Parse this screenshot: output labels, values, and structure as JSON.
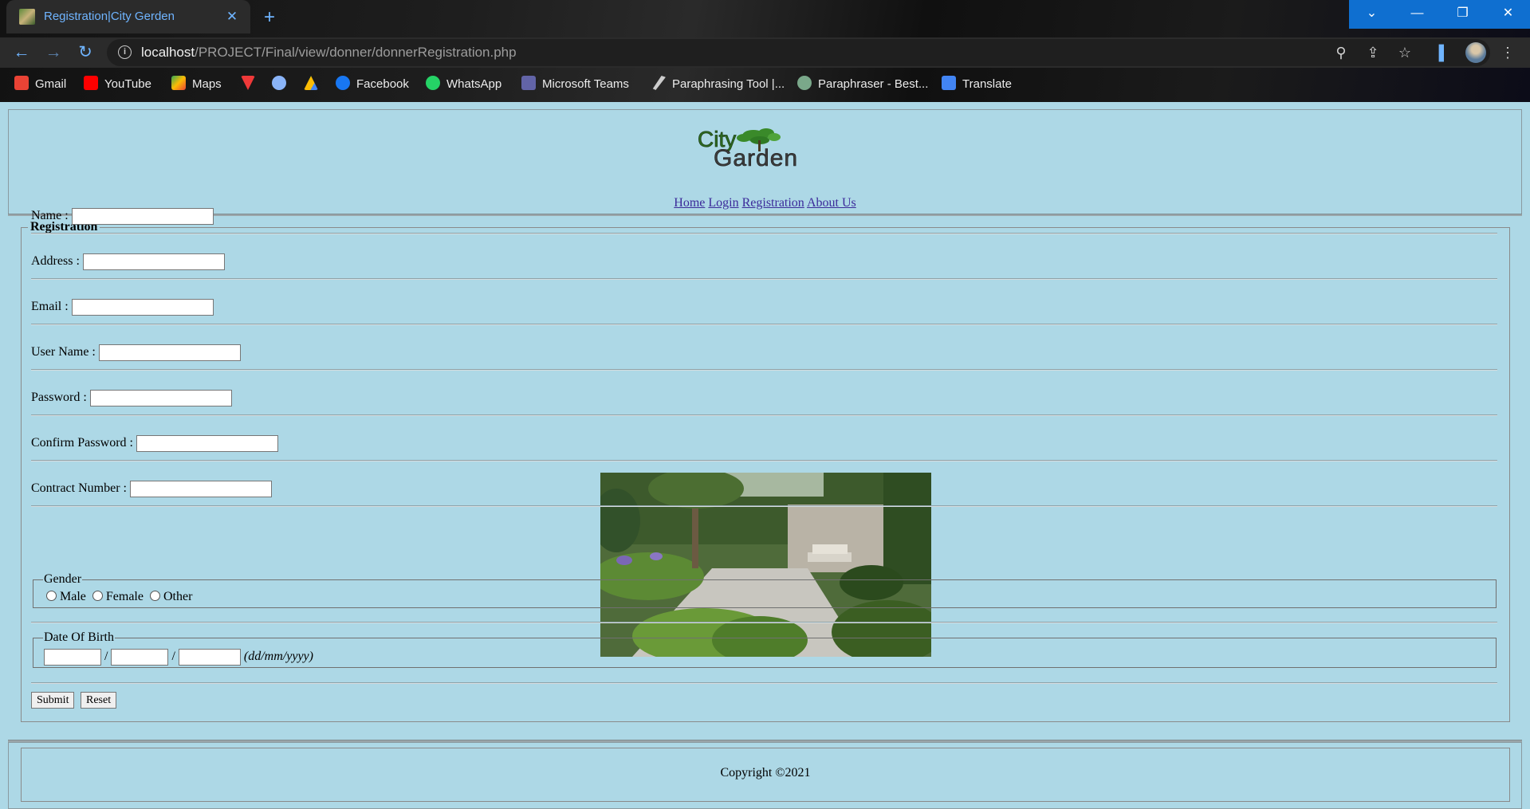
{
  "browser": {
    "tab_title": "Registration|City Gerden",
    "url_host": "localhost",
    "url_path": "/PROJECT/Final/view/donner/donnerRegistration.php",
    "bookmarks": [
      {
        "label": "Gmail",
        "icon": "gmail-icon",
        "color": "#ea4335"
      },
      {
        "label": "YouTube",
        "icon": "youtube-icon",
        "color": "#ff0000"
      },
      {
        "label": "Maps",
        "icon": "maps-icon",
        "color": "#34a853"
      },
      {
        "label": "",
        "icon": "vivaldi-icon",
        "color": "#ef3939"
      },
      {
        "label": "",
        "icon": "shield-icon",
        "color": "#8ab4f8"
      },
      {
        "label": "",
        "icon": "drive-icon",
        "color": "#fbbc04"
      },
      {
        "label": "Facebook",
        "icon": "facebook-icon",
        "color": "#1877f2"
      },
      {
        "label": "WhatsApp",
        "icon": "whatsapp-icon",
        "color": "#25d366"
      },
      {
        "label": "Microsoft Teams",
        "icon": "teams-icon",
        "color": "#6264a7"
      },
      {
        "label": "Paraphrasing Tool |...",
        "icon": "quill-icon",
        "color": "#cccccc"
      },
      {
        "label": "Paraphraser - Best...",
        "icon": "paraphraser-icon",
        "color": "#7aa88a"
      },
      {
        "label": "Translate",
        "icon": "translate-icon",
        "color": "#4285f4"
      }
    ]
  },
  "site": {
    "logo_text_top": "City",
    "logo_text_bottom": "Garden",
    "nav": [
      "Home",
      "Login",
      "Registration",
      "About Us"
    ]
  },
  "form": {
    "legend": "Registration",
    "fields": {
      "name": "Name :",
      "address": "Address :",
      "email": "Email :",
      "username": "User Name :",
      "password": "Password :",
      "confirm_password": "Confirm Password :",
      "contact_number": "Contract Number :"
    },
    "gender": {
      "legend": "Gender",
      "options": [
        "Male",
        "Female",
        "Other"
      ]
    },
    "dob": {
      "legend": "Date Of Birth",
      "separator": "/",
      "hint": "(dd/mm/yyyy)"
    },
    "submit": "Submit",
    "reset": "Reset"
  },
  "footer": {
    "copyright": "Copyright ©2021"
  }
}
